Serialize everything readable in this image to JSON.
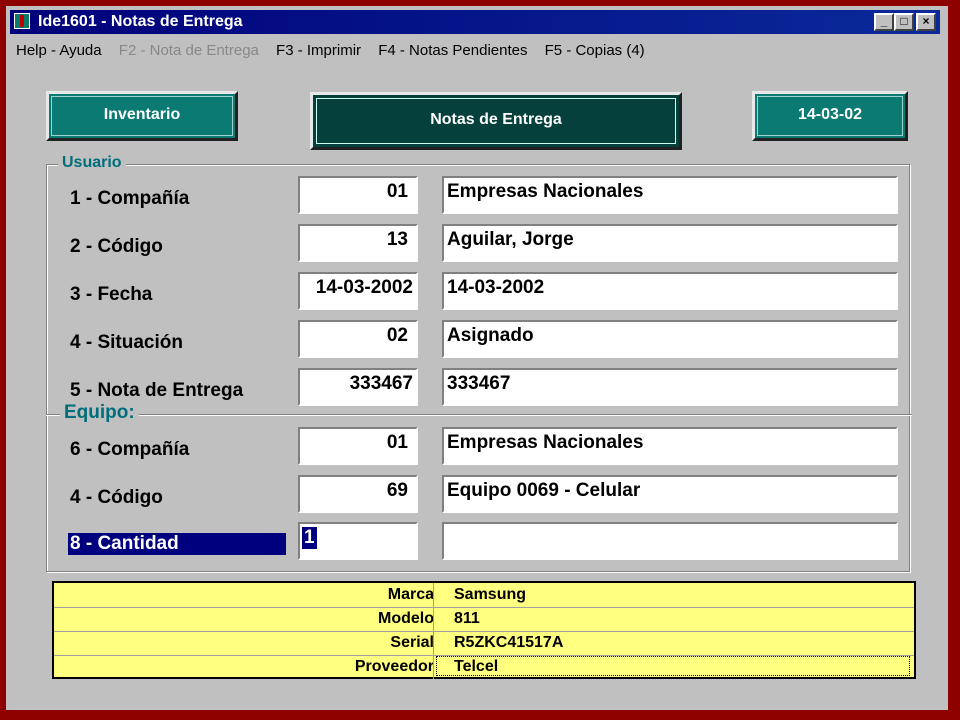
{
  "window": {
    "title": "Ide1601 - Notas de Entrega",
    "controls": {
      "minimize": "_",
      "maximize": "□",
      "close": "×"
    }
  },
  "menu": [
    {
      "label": "Help - Ayuda",
      "enabled": true
    },
    {
      "label": "F2 - Nota de Entrega",
      "enabled": false
    },
    {
      "label": "F3 - Imprimir",
      "enabled": true
    },
    {
      "label": "F4 - Notas Pendientes",
      "enabled": true
    },
    {
      "label": "F5 - Copias (4)",
      "enabled": true
    }
  ],
  "header": {
    "inventory_button": "Inventario",
    "main_title": "Notas de Entrega",
    "date_button": "14-03-02"
  },
  "usuario": {
    "group_label": "Usuario",
    "rows": [
      {
        "label": "1 - Compañía",
        "code": "01",
        "desc": "Empresas Nacionales"
      },
      {
        "label": "2 - Código",
        "code": "13",
        "desc": "Aguilar, Jorge"
      },
      {
        "label": "3 - Fecha",
        "code": "14-03-2002",
        "desc": "14-03-2002"
      },
      {
        "label": "4 - Situación",
        "code": "02",
        "desc": "Asignado"
      },
      {
        "label": "5 - Nota de Entrega",
        "code": "333467",
        "desc": "333467"
      }
    ]
  },
  "equipo": {
    "group_label": "Equipo:",
    "rows": [
      {
        "label": "6 - Compañía",
        "code": "01",
        "desc": "Empresas Nacionales"
      },
      {
        "label": "4 - Código",
        "code": "69",
        "desc": "Equipo 0069 - Celular"
      },
      {
        "label": "8 - Cantidad",
        "code": "1",
        "desc": ""
      }
    ]
  },
  "details": [
    {
      "key": "Marca",
      "value": "Samsung"
    },
    {
      "key": "Modelo",
      "value": "811"
    },
    {
      "key": "Serial",
      "value": "R5ZKC41517A"
    },
    {
      "key": "Proveedor",
      "value": "Telcel"
    }
  ],
  "colors": {
    "desktop": "#8e0000",
    "titlebar": "#00007a",
    "accent_teal": "#0a7a72",
    "dark_teal": "#05403d",
    "group_label": "#006e7a",
    "selection": "#00007f",
    "info_panel": "#ffff80"
  }
}
